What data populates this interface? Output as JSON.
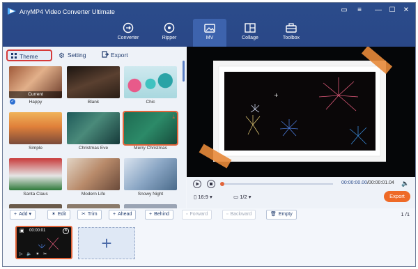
{
  "app": {
    "title": "AnyMP4 Video Converter Ultimate"
  },
  "tabs": [
    {
      "label": "Converter",
      "icon": "converter-icon"
    },
    {
      "label": "Ripper",
      "icon": "ripper-icon"
    },
    {
      "label": "MV",
      "icon": "mv-icon",
      "active": true
    },
    {
      "label": "Collage",
      "icon": "collage-icon"
    },
    {
      "label": "Toolbox",
      "icon": "toolbox-icon"
    }
  ],
  "subtabs": [
    {
      "label": "Theme",
      "selected": true
    },
    {
      "label": "Setting"
    },
    {
      "label": "Export"
    }
  ],
  "themes": [
    {
      "name": "Happy",
      "current": "Current"
    },
    {
      "name": "Blank"
    },
    {
      "name": "Chic"
    },
    {
      "name": "Simple"
    },
    {
      "name": "Christmas Eve"
    },
    {
      "name": "Merry Christmas"
    },
    {
      "name": "Santa Claus"
    },
    {
      "name": "Modern Life"
    },
    {
      "name": "Snowy Night"
    }
  ],
  "player": {
    "time_current": "00:00:00.00",
    "time_total": "/00:00:01.04",
    "aspect": "16:9",
    "page": "1/2",
    "export_label": "Export"
  },
  "toolbar": {
    "add": "Add",
    "edit": "Edit",
    "trim": "Trim",
    "ahead": "Ahead",
    "behind": "Behind",
    "forward": "Forward",
    "backward": "Backward",
    "empty": "Empty",
    "pager": "1 /1"
  },
  "clip": {
    "time": "00:00:01"
  },
  "colors": {
    "accent": "#ee6a27",
    "header": "#2b4c8b",
    "selection": "#d63a3a"
  }
}
